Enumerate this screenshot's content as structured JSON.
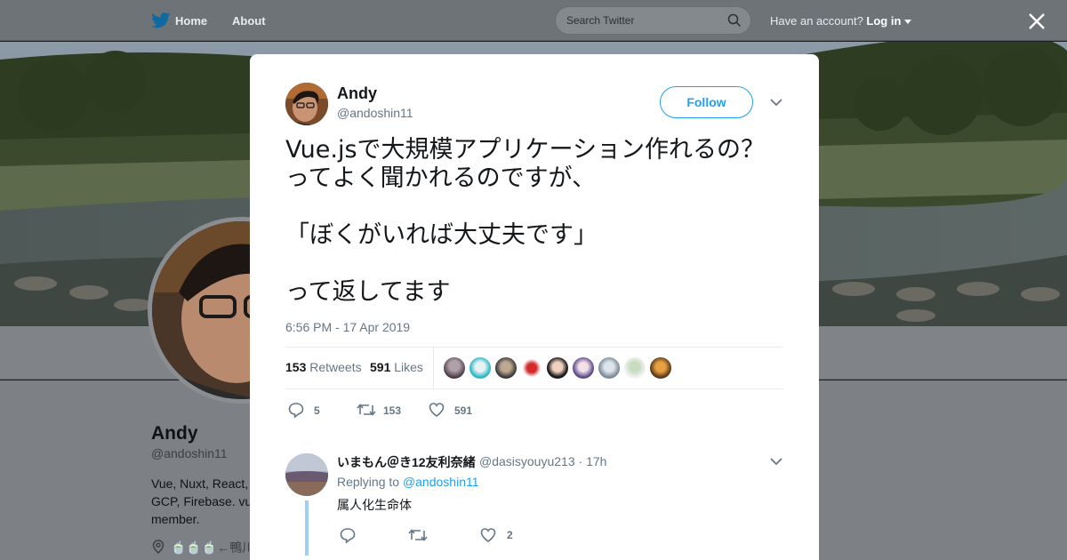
{
  "nav": {
    "home_label": "Home",
    "about_label": "About",
    "search_placeholder": "Search Twitter",
    "account_prompt": "Have an account?",
    "login_label": "Log in"
  },
  "profile": {
    "name": "Andy",
    "handle": "@andoshin11",
    "bio": "Vue, Nuxt, React,\nGCP, Firebase. vu\nmember.",
    "location": "🍵🍵🍵←鴨川"
  },
  "tweet": {
    "author_name": "Andy",
    "author_handle": "@andoshin11",
    "follow_label": "Follow",
    "text": "Vue.jsで大規模アプリケーション作れるの？\nってよく聞かれるのですが、\n\n「ぼくがいれば大丈夫です」\n\nって返してます",
    "timestamp": "6:56 PM - 17 Apr 2019",
    "retweets_count": "153",
    "retweets_label": "Retweets",
    "likes_count": "591",
    "likes_label": "Likes",
    "reply_count": "5",
    "retweet_count_action": "153",
    "like_count_action": "591"
  },
  "reply": {
    "author_name": "いまもん＠き12友利奈緒",
    "author_handle": "@dasisyouyu213",
    "age": "17h",
    "replying_label": "Replying to",
    "replying_to": "@andoshin11",
    "text": "属人化生命体",
    "like_count": "2"
  },
  "colors": {
    "accent": "#1da1f2",
    "secondary_text": "#657786",
    "divider": "#e6ecf0"
  }
}
